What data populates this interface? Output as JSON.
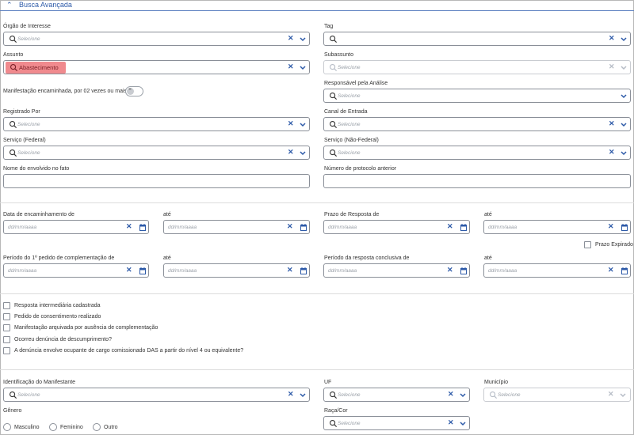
{
  "section": {
    "title": "Busca Avançada"
  },
  "placeholders": {
    "select": "Selecione",
    "date": "dd/mm/aaaa"
  },
  "fields": {
    "orgao": "Órgão de Interesse",
    "tag": "Tag",
    "assunto": "Assunto",
    "assunto_value": "Abastecimento",
    "subassunto": "Subassunto",
    "manifestacao_toggle": "Manifestação encaminhada, por 02 vezes ou mais",
    "responsavel": "Responsável pela Análise",
    "registrado_por": "Registrado Por",
    "canal_entrada": "Canal de Entrada",
    "servico_federal": "Serviço (Federal)",
    "servico_nao_federal": "Serviço (Não-Federal)",
    "nome_envolvido": "Nome do envolvido no fato",
    "protocolo_anterior": "Número de protocolo anterior",
    "data_encaminhamento": "Data de encaminhamento de",
    "ate": "até",
    "prazo_resposta": "Prazo de Resposta de",
    "prazo_expirado": "Prazo Expirado",
    "periodo_complementacao": "Período do 1º pedido de complementação de",
    "periodo_resposta_conclusiva": "Período da resposta conclusiva de",
    "identificacao_manifestante": "Identificação do Manifestante",
    "uf": "UF",
    "municipio": "Município",
    "genero": "Gênero",
    "raca_cor": "Raça/Cor"
  },
  "checkboxes": [
    "Resposta intermediária cadastrada",
    "Pedido de consentimento realizado",
    "Manifestação arquivada por ausência de complementação",
    "Ocorreu denúncia de descumprimento?",
    "A denúncia envolve ocupante de cargo comissionado DAS a partir do nível 4 ou equivalente?"
  ],
  "genero_options": [
    "Masculino",
    "Feminino",
    "Outro"
  ],
  "icons": {
    "search": "search-icon",
    "clear": "clear-icon",
    "dropdown": "chevron-down-icon",
    "calendar": "calendar-icon"
  },
  "colors": {
    "accent": "#2d5aa8",
    "chip": "#f08a8e"
  }
}
